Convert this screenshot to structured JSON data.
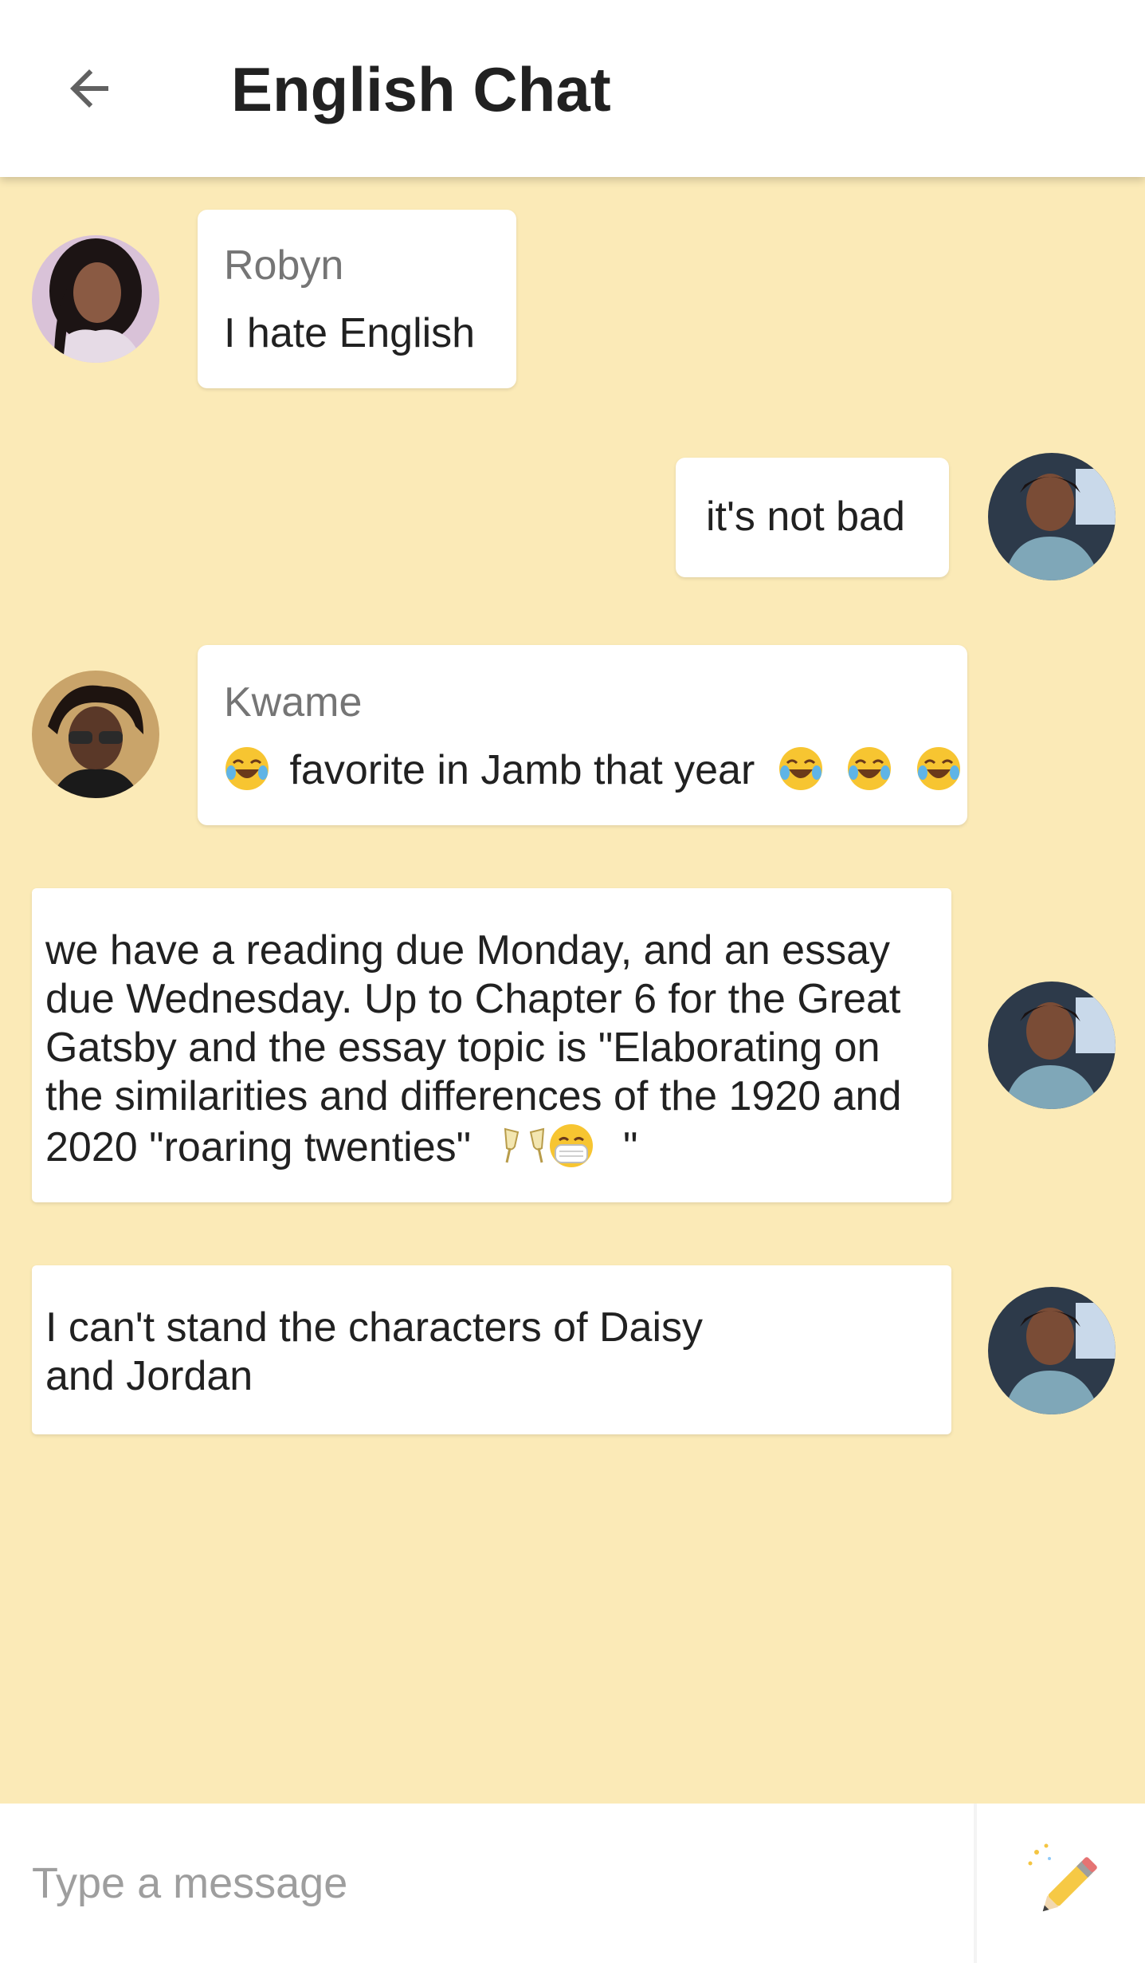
{
  "header": {
    "title": "English Chat",
    "back_icon": "arrow-left-icon"
  },
  "messages": [
    {
      "sender": "Robyn",
      "text": "I hate English",
      "side": "left"
    },
    {
      "sender": "",
      "text": "it's not bad",
      "side": "right"
    },
    {
      "sender": "Kwame",
      "text": "favorite in Jamb that year",
      "emojis_before": [
        "laughing-tears-emoji"
      ],
      "emojis_after": [
        "laughing-tears-emoji",
        "laughing-tears-emoji",
        "laughing-tears-emoji"
      ],
      "side": "left"
    },
    {
      "sender": "",
      "lines": [
        "we have a reading due Monday, and an essay",
        "due Wednesday. Up to Chapter 6 for the Great",
        "Gatsby and the essay topic is \"Elaborating on",
        "the similarities and differences of the 1920 and",
        "2020 \"roaring twenties\""
      ],
      "trailing_quote": "\"",
      "emojis": [
        "clinking-glasses-emoji",
        "face-with-mask-emoji"
      ],
      "side": "right"
    },
    {
      "sender": "",
      "lines": [
        "I can't stand the characters of Daisy",
        "and Jordan"
      ],
      "side": "right"
    }
  ],
  "composer": {
    "placeholder": "Type a message",
    "send_icon": "magic-wand-pencil-icon"
  },
  "colors": {
    "background": "#fbeab7",
    "bubble": "#ffffff",
    "title": "#212121",
    "sender": "#757575"
  }
}
